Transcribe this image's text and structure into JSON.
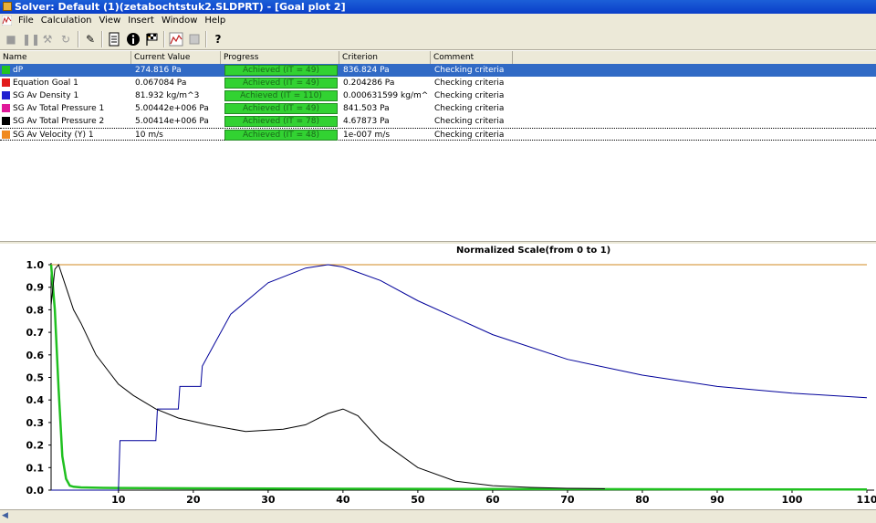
{
  "window": {
    "title": "Solver: Default (1)(zetabochtstuk2.SLDPRT) - [Goal plot 2]"
  },
  "menu": [
    "File",
    "Calculation",
    "View",
    "Insert",
    "Window",
    "Help"
  ],
  "toolbar": {
    "buttons": [
      "stop-icon",
      "pause-icon",
      "wrench-icon",
      "refresh-icon",
      "pin-icon",
      "log-icon",
      "info-icon",
      "goals-flag-icon",
      "goal-plot-icon",
      "preview-icon",
      "help-icon"
    ]
  },
  "grid": {
    "columns": [
      "Name",
      "Current Value",
      "Progress",
      "Criterion",
      "Comment"
    ],
    "rows": [
      {
        "name": "dP",
        "color": "#21c321",
        "current": "274.816 Pa",
        "progress": "Achieved (IT = 49)",
        "criterion": "836.824 Pa",
        "comment": "Checking criteria"
      },
      {
        "name": "Equation Goal 1",
        "color": "#e21b1b",
        "current": "0.067084 Pa",
        "progress": "Achieved (IT = 49)",
        "criterion": "0.204286 Pa",
        "comment": "Checking criteria"
      },
      {
        "name": "SG Av Density 1",
        "color": "#2020d0",
        "current": "81.932 kg/m^3",
        "progress": "Achieved (IT = 110)",
        "criterion": "0.000631599 kg/m^3",
        "comment": "Checking criteria"
      },
      {
        "name": "SG Av Total Pressure 1",
        "color": "#e0189a",
        "current": "5.00442e+006 Pa",
        "progress": "Achieved (IT = 49)",
        "criterion": "841.503 Pa",
        "comment": "Checking criteria"
      },
      {
        "name": "SG Av Total Pressure 2",
        "color": "#000000",
        "current": "5.00414e+006 Pa",
        "progress": "Achieved (IT = 78)",
        "criterion": "4.67873 Pa",
        "comment": "Checking criteria"
      },
      {
        "name": "SG Av Velocity (Y) 1",
        "color": "#f08a20",
        "current": "10 m/s",
        "progress": "Achieved (IT = 48)",
        "criterion": "1e-007 m/s",
        "comment": "Checking criteria"
      }
    ],
    "progress_fraction": 1.0
  },
  "chart_data": {
    "type": "line",
    "title": "Normalized Scale(from 0 to 1)",
    "xlim": [
      1,
      110
    ],
    "ylim": [
      0,
      1
    ],
    "xticks": [
      10,
      20,
      30,
      40,
      50,
      60,
      70,
      80,
      90,
      100,
      110
    ],
    "yticks": [
      "0.0",
      "0.1",
      "0.2",
      "0.3",
      "0.4",
      "0.5",
      "0.6",
      "0.7",
      "0.8",
      "0.9",
      "1.0"
    ],
    "grid": false,
    "series": [
      {
        "color": "#d08a20",
        "x": [
          1,
          110
        ],
        "y": [
          1.0,
          1.0
        ]
      },
      {
        "color": "#20c020",
        "x": [
          1,
          1.5,
          2,
          2.5,
          3,
          3.5,
          4,
          5,
          8,
          20,
          40,
          60,
          80,
          110
        ],
        "y": [
          1.0,
          0.8,
          0.45,
          0.15,
          0.05,
          0.02,
          0.015,
          0.012,
          0.01,
          0.008,
          0.006,
          0.005,
          0.004,
          0.003
        ]
      },
      {
        "color": "#00009a",
        "x": [
          1,
          5,
          10,
          10.2,
          13,
          15,
          15.2,
          17,
          18,
          18.2,
          20,
          21,
          21.2,
          25,
          30,
          35,
          38,
          40,
          45,
          50,
          60,
          70,
          80,
          90,
          100,
          110
        ],
        "y": [
          0,
          0,
          0,
          0.22,
          0.22,
          0.22,
          0.36,
          0.36,
          0.36,
          0.46,
          0.46,
          0.46,
          0.55,
          0.78,
          0.92,
          0.985,
          1.0,
          0.99,
          0.93,
          0.84,
          0.69,
          0.58,
          0.51,
          0.46,
          0.43,
          0.41
        ]
      },
      {
        "color": "#000000",
        "x": [
          1,
          1.5,
          2,
          3,
          4,
          5,
          7,
          10,
          12,
          15,
          18,
          22,
          27,
          32,
          35,
          38,
          40,
          42,
          45,
          50,
          55,
          60,
          65,
          70,
          75
        ],
        "y": [
          0.82,
          0.98,
          1.0,
          0.9,
          0.8,
          0.74,
          0.6,
          0.47,
          0.42,
          0.36,
          0.32,
          0.29,
          0.26,
          0.27,
          0.29,
          0.34,
          0.36,
          0.33,
          0.22,
          0.1,
          0.04,
          0.02,
          0.012,
          0.008,
          0.006
        ]
      }
    ]
  }
}
